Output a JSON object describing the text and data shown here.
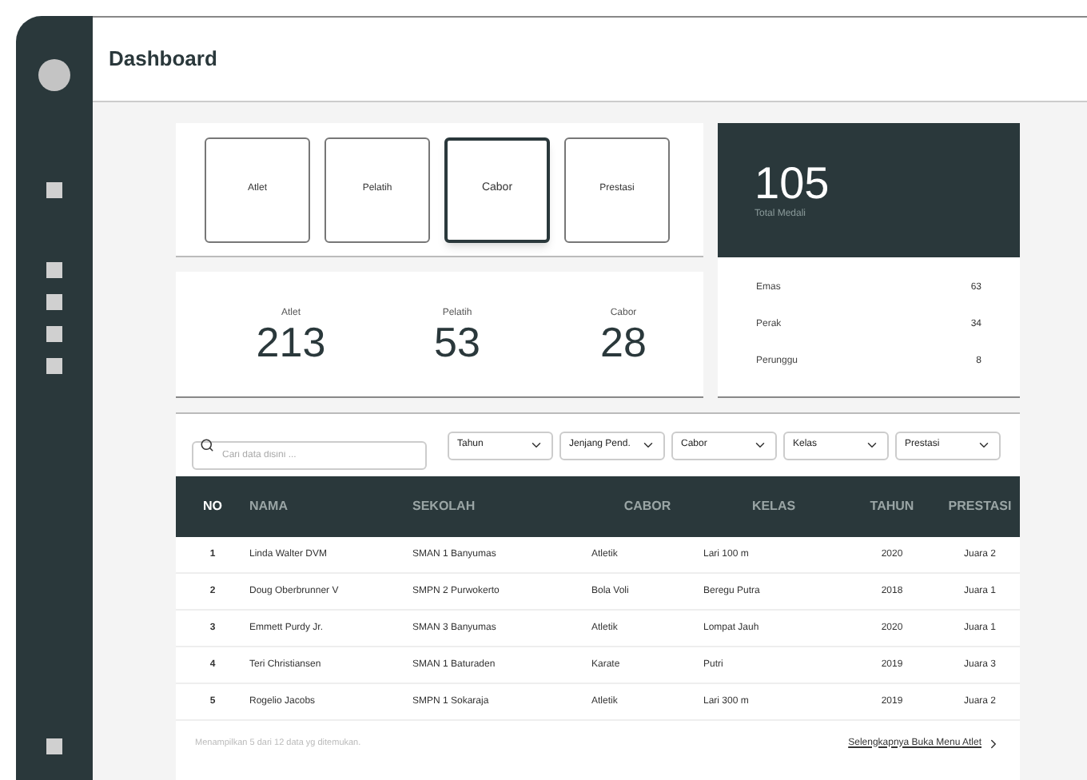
{
  "header": {
    "title": "Dashboard"
  },
  "category_tiles": [
    {
      "label": "Atlet",
      "selected": false
    },
    {
      "label": "Pelatih",
      "selected": false
    },
    {
      "label": "Cabor",
      "selected": true
    },
    {
      "label": "Prestasi",
      "selected": false
    }
  ],
  "counts": [
    {
      "label": "Atlet",
      "value": "213"
    },
    {
      "label": "Pelatih",
      "value": "53"
    },
    {
      "label": "Cabor",
      "value": "28"
    }
  ],
  "medals": {
    "total": "105",
    "total_label": "Total Medali",
    "rows": [
      {
        "label": "Emas",
        "value": "63"
      },
      {
        "label": "Perak",
        "value": "34"
      },
      {
        "label": "Perunggu",
        "value": "8"
      }
    ]
  },
  "filters": {
    "search_placeholder": "Cari data disini ...",
    "dropdowns": [
      "Tahun",
      "Jenjang Pend.",
      "Cabor",
      "Kelas",
      "Prestasi"
    ]
  },
  "table": {
    "columns": [
      "NO",
      "NAMA",
      "SEKOLAH",
      "CABOR",
      "KELAS",
      "TAHUN",
      "PRESTASI"
    ],
    "rows": [
      [
        "1",
        "Linda Walter DVM",
        "SMAN 1 Banyumas",
        "Atletik",
        "Lari 100 m",
        "2020",
        "Juara 2"
      ],
      [
        "2",
        "Doug Oberbrunner V",
        "SMPN 2 Purwokerto",
        "Bola Voli",
        "Beregu Putra",
        "2018",
        "Juara 1"
      ],
      [
        "3",
        "Emmett Purdy Jr.",
        "SMAN 3 Banyumas",
        "Atletik",
        "Lompat Jauh",
        "2020",
        "Juara 1"
      ],
      [
        "4",
        "Teri Christiansen",
        "SMAN 1 Baturaden",
        "Karate",
        "Putri",
        "2019",
        "Juara 3"
      ],
      [
        "5",
        "Rogelio Jacobs",
        "SMPN 1 Sokaraja",
        "Atletik",
        "Lari 300 m",
        "2019",
        "Juara 2"
      ]
    ],
    "footer_note": "Menampilkan 5 dari 12 data yg ditemukan.",
    "more_link": "Selengkapnya Buka Menu Atlet"
  }
}
